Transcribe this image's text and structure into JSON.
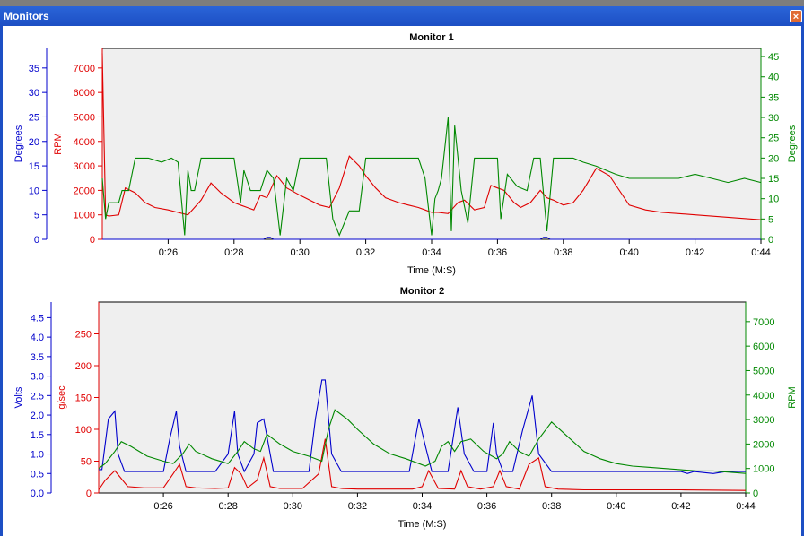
{
  "window": {
    "title": "Monitors",
    "close_glyph": "×"
  },
  "colors": {
    "blue": "#0000cc",
    "red": "#e00000",
    "green": "#008800",
    "plot_bg": "#efefef",
    "title_bar": "#1d4fc4"
  },
  "x_axis": {
    "ticks": [
      "0:26",
      "0:28",
      "0:30",
      "0:32",
      "0:34",
      "0:36",
      "0:38",
      "0:40",
      "0:42",
      "0:44"
    ],
    "label": "Time (M:S)"
  },
  "chart_data": [
    {
      "type": "line",
      "title": "Monitor 1",
      "xlabel": "Time (M:S)",
      "xlim": [
        24,
        44
      ],
      "axes": [
        {
          "side": "left",
          "label": "Degrees",
          "color": "#0000cc",
          "ylim": [
            0,
            39
          ],
          "ticks": [
            0,
            5,
            10,
            15,
            20,
            25,
            30,
            35
          ]
        },
        {
          "side": "left",
          "label": "RPM",
          "color": "#e00000",
          "ylim": [
            0,
            7800
          ],
          "ticks": [
            0,
            1000,
            2000,
            3000,
            4000,
            5000,
            6000,
            7000
          ]
        },
        {
          "side": "right",
          "label": "Degrees",
          "color": "#008800",
          "ylim": [
            0,
            47
          ],
          "ticks": [
            0,
            5,
            10,
            15,
            20,
            25,
            30,
            35,
            40,
            45
          ]
        }
      ],
      "series": [
        {
          "axis": 1,
          "color": "#e00000",
          "x": [
            24.0,
            24.1,
            24.2,
            24.5,
            24.7,
            25.0,
            25.3,
            25.6,
            26.0,
            26.3,
            26.6,
            27.0,
            27.3,
            27.6,
            28.0,
            28.2,
            28.4,
            28.6,
            28.8,
            29.0,
            29.3,
            29.6,
            30.0,
            30.3,
            30.6,
            30.9,
            31.2,
            31.5,
            31.8,
            32.0,
            32.3,
            32.6,
            33.0,
            33.3,
            33.6,
            33.8,
            34.0,
            34.2,
            34.5,
            34.8,
            35.0,
            35.3,
            35.6,
            35.8,
            36.0,
            36.2,
            36.5,
            36.7,
            37.0,
            37.3,
            37.5,
            37.7,
            38.0,
            38.3,
            38.6,
            39.0,
            39.4,
            40.0,
            40.5,
            41.0,
            41.5,
            42.0,
            42.5,
            43.0,
            43.5,
            44.0
          ],
          "y": [
            7600,
            1000,
            950,
            1000,
            2100,
            1900,
            1500,
            1300,
            1200,
            1100,
            1000,
            1600,
            2300,
            1900,
            1500,
            1400,
            1300,
            1200,
            1800,
            1700,
            2600,
            2100,
            1800,
            1600,
            1400,
            1300,
            2100,
            3400,
            3000,
            2600,
            2100,
            1700,
            1500,
            1400,
            1300,
            1200,
            1100,
            1100,
            1050,
            1500,
            1600,
            1200,
            1300,
            2200,
            2100,
            2000,
            1500,
            1300,
            1500,
            2000,
            1700,
            1600,
            1400,
            1500,
            2000,
            2900,
            2600,
            1400,
            1200,
            1100,
            1050,
            1000,
            950,
            900,
            850,
            800
          ]
        },
        {
          "axis": 2,
          "color": "#008800",
          "x": [
            24.0,
            24.1,
            24.2,
            24.5,
            24.6,
            24.8,
            25.0,
            25.4,
            25.8,
            26.1,
            26.3,
            26.5,
            26.6,
            26.7,
            26.8,
            27.0,
            27.3,
            27.6,
            28.0,
            28.2,
            28.3,
            28.5,
            28.8,
            29.0,
            29.2,
            29.4,
            29.6,
            29.8,
            30.0,
            30.3,
            30.6,
            30.8,
            31.0,
            31.2,
            31.5,
            31.8,
            32.0,
            32.3,
            32.8,
            33.3,
            33.6,
            33.8,
            34.0,
            34.1,
            34.2,
            34.3,
            34.5,
            34.6,
            34.7,
            34.8,
            34.9,
            35.0,
            35.1,
            35.3,
            35.5,
            35.8,
            36.0,
            36.1,
            36.3,
            36.6,
            36.9,
            37.1,
            37.3,
            37.5,
            37.7,
            38.0,
            38.3,
            38.6,
            39.0,
            39.3,
            39.6,
            40.0,
            40.5,
            41.0,
            41.5,
            42.0,
            42.5,
            43.0,
            43.5,
            44.0
          ],
          "y": [
            15,
            5,
            9,
            9,
            12,
            12,
            20,
            20,
            19,
            20,
            19,
            1,
            17,
            12,
            12,
            20,
            20,
            20,
            20,
            9,
            17,
            12,
            12,
            17,
            15,
            1,
            15,
            12,
            20,
            20,
            20,
            20,
            5,
            1,
            7,
            7,
            20,
            20,
            20,
            20,
            20,
            15,
            1,
            10,
            12,
            15,
            30,
            2,
            28,
            20,
            12,
            8,
            4,
            20,
            20,
            20,
            20,
            5,
            16,
            13,
            12,
            20,
            20,
            2,
            20,
            20,
            20,
            19,
            18,
            17,
            16,
            15,
            15,
            15,
            15,
            16,
            15,
            14,
            15,
            14
          ]
        },
        {
          "axis": 0,
          "color": "#0000cc",
          "x": [
            24.0,
            28.9,
            29.0,
            29.1,
            29.2,
            37.3,
            37.4,
            37.5,
            37.6,
            44.0
          ],
          "y": [
            0,
            0,
            0.4,
            0.4,
            0,
            0,
            0.4,
            0.4,
            0,
            0
          ]
        }
      ]
    },
    {
      "type": "line",
      "title": "Monitor 2",
      "xlabel": "Time (M:S)",
      "xlim": [
        24,
        44
      ],
      "axes": [
        {
          "side": "left",
          "label": "Volts",
          "color": "#0000cc",
          "ylim": [
            0,
            4.9
          ],
          "ticks": [
            0.0,
            0.5,
            1.0,
            1.5,
            2.0,
            2.5,
            3.0,
            3.5,
            4.0,
            4.5
          ]
        },
        {
          "side": "left",
          "label": "g/sec",
          "color": "#e00000",
          "ylim": [
            0,
            300
          ],
          "ticks": [
            0,
            50,
            100,
            150,
            200,
            250
          ]
        },
        {
          "side": "right",
          "label": "RPM",
          "color": "#008800",
          "ylim": [
            0,
            7800
          ],
          "ticks": [
            0,
            1000,
            2000,
            3000,
            4000,
            5000,
            6000,
            7000
          ]
        }
      ],
      "series": [
        {
          "axis": 0,
          "color": "#0000cc",
          "x": [
            24.0,
            24.1,
            24.3,
            24.5,
            24.6,
            24.8,
            25.2,
            26.0,
            26.2,
            26.4,
            26.5,
            26.7,
            27.0,
            27.6,
            28.0,
            28.2,
            28.3,
            28.5,
            28.8,
            28.9,
            29.1,
            29.4,
            29.6,
            30.0,
            30.5,
            30.7,
            30.9,
            31.0,
            31.2,
            31.5,
            32.0,
            33.0,
            33.6,
            33.9,
            34.1,
            34.3,
            34.8,
            35.1,
            35.3,
            35.6,
            36.0,
            36.2,
            36.3,
            36.5,
            36.8,
            37.1,
            37.4,
            37.6,
            38.0,
            39.0,
            40.0,
            41.0,
            42.0,
            42.2,
            42.4,
            43.0,
            43.4,
            44.0
          ],
          "y": [
            0.6,
            0.6,
            1.9,
            2.1,
            1.0,
            0.55,
            0.55,
            0.55,
            1.4,
            2.1,
            1.2,
            0.55,
            0.55,
            0.55,
            1.0,
            2.1,
            1.0,
            0.55,
            1.0,
            1.8,
            1.9,
            0.55,
            0.55,
            0.55,
            0.55,
            1.9,
            2.9,
            2.9,
            1.0,
            0.55,
            0.55,
            0.55,
            0.55,
            1.9,
            1.2,
            0.55,
            0.55,
            2.2,
            1.0,
            0.55,
            0.55,
            1.8,
            1.0,
            0.55,
            0.55,
            1.6,
            2.5,
            1.0,
            0.55,
            0.55,
            0.55,
            0.55,
            0.55,
            0.5,
            0.55,
            0.5,
            0.55,
            0.55
          ]
        },
        {
          "axis": 1,
          "color": "#e00000",
          "x": [
            24.0,
            24.2,
            24.5,
            24.9,
            25.4,
            26.0,
            26.3,
            26.5,
            26.7,
            27.0,
            27.6,
            28.0,
            28.2,
            28.4,
            28.6,
            28.9,
            29.1,
            29.3,
            29.6,
            30.3,
            30.8,
            31.0,
            31.2,
            31.5,
            32.0,
            33.0,
            33.7,
            34.0,
            34.2,
            34.5,
            35.0,
            35.2,
            35.4,
            35.8,
            36.2,
            36.4,
            36.6,
            37.0,
            37.3,
            37.6,
            37.8,
            38.2,
            39.0,
            40.0,
            42.0,
            44.0
          ],
          "y": [
            5,
            20,
            35,
            10,
            8,
            8,
            30,
            45,
            10,
            8,
            7,
            8,
            40,
            30,
            8,
            20,
            55,
            10,
            7,
            7,
            30,
            85,
            10,
            7,
            6,
            6,
            6,
            10,
            35,
            7,
            6,
            35,
            10,
            6,
            10,
            35,
            10,
            6,
            45,
            55,
            10,
            6,
            5,
            5,
            5,
            4
          ]
        },
        {
          "axis": 2,
          "color": "#008800",
          "x": [
            24.0,
            24.2,
            24.5,
            24.7,
            25.0,
            25.5,
            26.0,
            26.3,
            26.6,
            26.8,
            27.0,
            27.5,
            28.0,
            28.3,
            28.5,
            28.8,
            29.0,
            29.2,
            29.6,
            30.0,
            30.5,
            30.9,
            31.1,
            31.3,
            31.7,
            32.0,
            32.5,
            33.0,
            33.5,
            33.9,
            34.1,
            34.4,
            34.6,
            34.8,
            35.0,
            35.2,
            35.5,
            35.9,
            36.3,
            36.5,
            36.7,
            37.0,
            37.3,
            37.6,
            38.0,
            38.5,
            39.0,
            39.5,
            40.0,
            40.5,
            41.0,
            41.5,
            42.0,
            42.5,
            43.0,
            43.5,
            44.0
          ],
          "y": [
            1000,
            1200,
            1700,
            2100,
            1900,
            1500,
            1300,
            1200,
            1600,
            2000,
            1700,
            1400,
            1200,
            1700,
            2100,
            1800,
            1700,
            2400,
            2000,
            1700,
            1500,
            1300,
            2600,
            3400,
            3000,
            2600,
            2000,
            1600,
            1400,
            1200,
            1100,
            1300,
            1900,
            2100,
            1700,
            2100,
            2200,
            1700,
            1400,
            1600,
            2100,
            1700,
            1500,
            2200,
            2900,
            2300,
            1700,
            1400,
            1200,
            1100,
            1050,
            1000,
            950,
            900,
            900,
            850,
            800
          ]
        }
      ]
    }
  ]
}
